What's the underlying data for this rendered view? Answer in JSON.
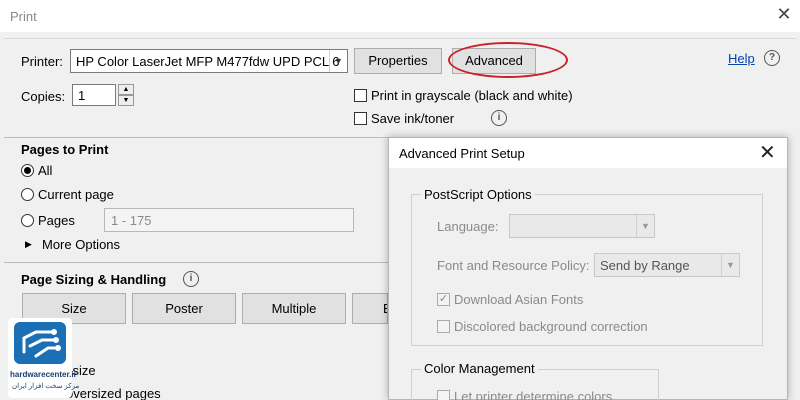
{
  "window": {
    "title": "Print",
    "close_glyph": "✕"
  },
  "printer": {
    "label": "Printer:",
    "selected": "HP Color LaserJet MFP M477fdw UPD PCL 6",
    "properties_label": "Properties",
    "advanced_label": "Advanced",
    "help_label": "Help"
  },
  "copies": {
    "label": "Copies:",
    "value": "1"
  },
  "options": {
    "grayscale_label": "Print in grayscale (black and white)",
    "save_ink_label": "Save ink/toner"
  },
  "pages_to_print": {
    "title": "Pages to Print",
    "all_label": "All",
    "current_label": "Current page",
    "pages_label": "Pages",
    "pages_value": "1 - 175",
    "more_label": "More Options"
  },
  "sizing": {
    "title": "Page Sizing & Handling",
    "buttons": [
      "Size",
      "Poster",
      "Multiple",
      "B"
    ],
    "actual_size_partial": "l size",
    "shrink_partial": "oversized pages"
  },
  "advanced_dialog": {
    "title": "Advanced Print Setup",
    "postscript_title": "PostScript Options",
    "language_label": "Language:",
    "language_value": "",
    "font_policy_label": "Font and Resource Policy:",
    "font_policy_value": "Send by Range",
    "download_asian_label": "Download Asian Fonts",
    "discolored_label": "Discolored background correction",
    "color_mgmt_title": "Color Management",
    "let_printer_label": "Let printer determine colors"
  },
  "watermark": {
    "brand": "hardwarecenter.ir",
    "sub": "مرکز سخت افزار ایران"
  },
  "colors": {
    "annotation_red": "#c8232c",
    "link_blue": "#0645ad",
    "logo_blue": "#1a6fb5"
  }
}
